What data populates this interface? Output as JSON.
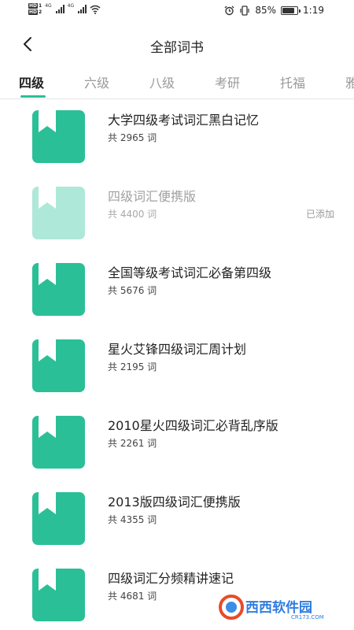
{
  "status_bar": {
    "hd1": "HD",
    "hd2": "HD",
    "sim1": "1",
    "sim2": "2",
    "net1": "4G",
    "net2": "4G",
    "battery_percent": "85%",
    "battery_level": 0.85,
    "time": "1:19",
    "icons": [
      "alarm-icon",
      "vibrate-icon",
      "wifi-icon",
      "battery-icon"
    ]
  },
  "header": {
    "title": "全部词书",
    "back_icon": "chevron-left-icon"
  },
  "tabs": [
    {
      "label": "四级",
      "active": true
    },
    {
      "label": "六级",
      "active": false
    },
    {
      "label": "八级",
      "active": false
    },
    {
      "label": "考研",
      "active": false
    },
    {
      "label": "托福",
      "active": false
    },
    {
      "label": "雅",
      "active": false
    }
  ],
  "accent_color": "#2bbf98",
  "books": [
    {
      "title": "大学四级考试词汇黑白记忆",
      "count": "共 2965 词",
      "status": ""
    },
    {
      "title": "四级词汇便携版",
      "count": "共 4400 词",
      "status": "已添加"
    },
    {
      "title": "全国等级考试词汇必备第四级",
      "count": "共 5676 词",
      "status": ""
    },
    {
      "title": "星火艾锋四级词汇周计划",
      "count": "共 2195 词",
      "status": ""
    },
    {
      "title": "2010星火四级词汇必背乱序版",
      "count": "共 2261 词",
      "status": ""
    },
    {
      "title": "2013版四级词汇便携版",
      "count": "共 4355 词",
      "status": ""
    },
    {
      "title": "四级词汇分频精讲速记",
      "count": "共 4681 词",
      "status": ""
    }
  ],
  "watermark": {
    "text": "西西软件园",
    "url_text": "CR173.COM"
  }
}
